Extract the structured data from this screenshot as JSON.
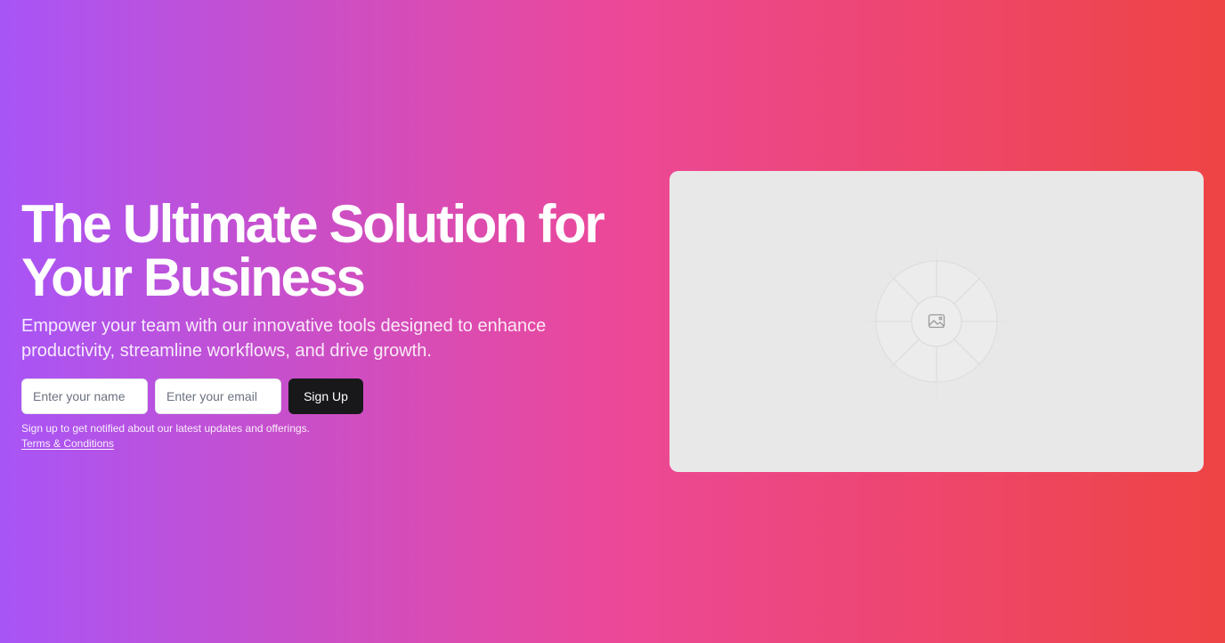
{
  "hero": {
    "headline": "The Ultimate Solution for Your Business",
    "subtitle": "Empower your team with our innovative tools designed to enhance productivity, streamline workflows, and drive growth.",
    "form": {
      "name_placeholder": "Enter your name",
      "email_placeholder": "Enter your email",
      "submit_label": "Sign Up"
    },
    "note": "Sign up to get notified about our latest updates and offerings.",
    "terms_label": "Terms & Conditions"
  },
  "media": {
    "icon": "image-icon"
  },
  "colors": {
    "gradient_start": "#a855f7",
    "gradient_mid": "#ec4899",
    "gradient_end": "#ef4444",
    "button": "#18181b",
    "placeholder_bg": "#e8e8e8"
  }
}
